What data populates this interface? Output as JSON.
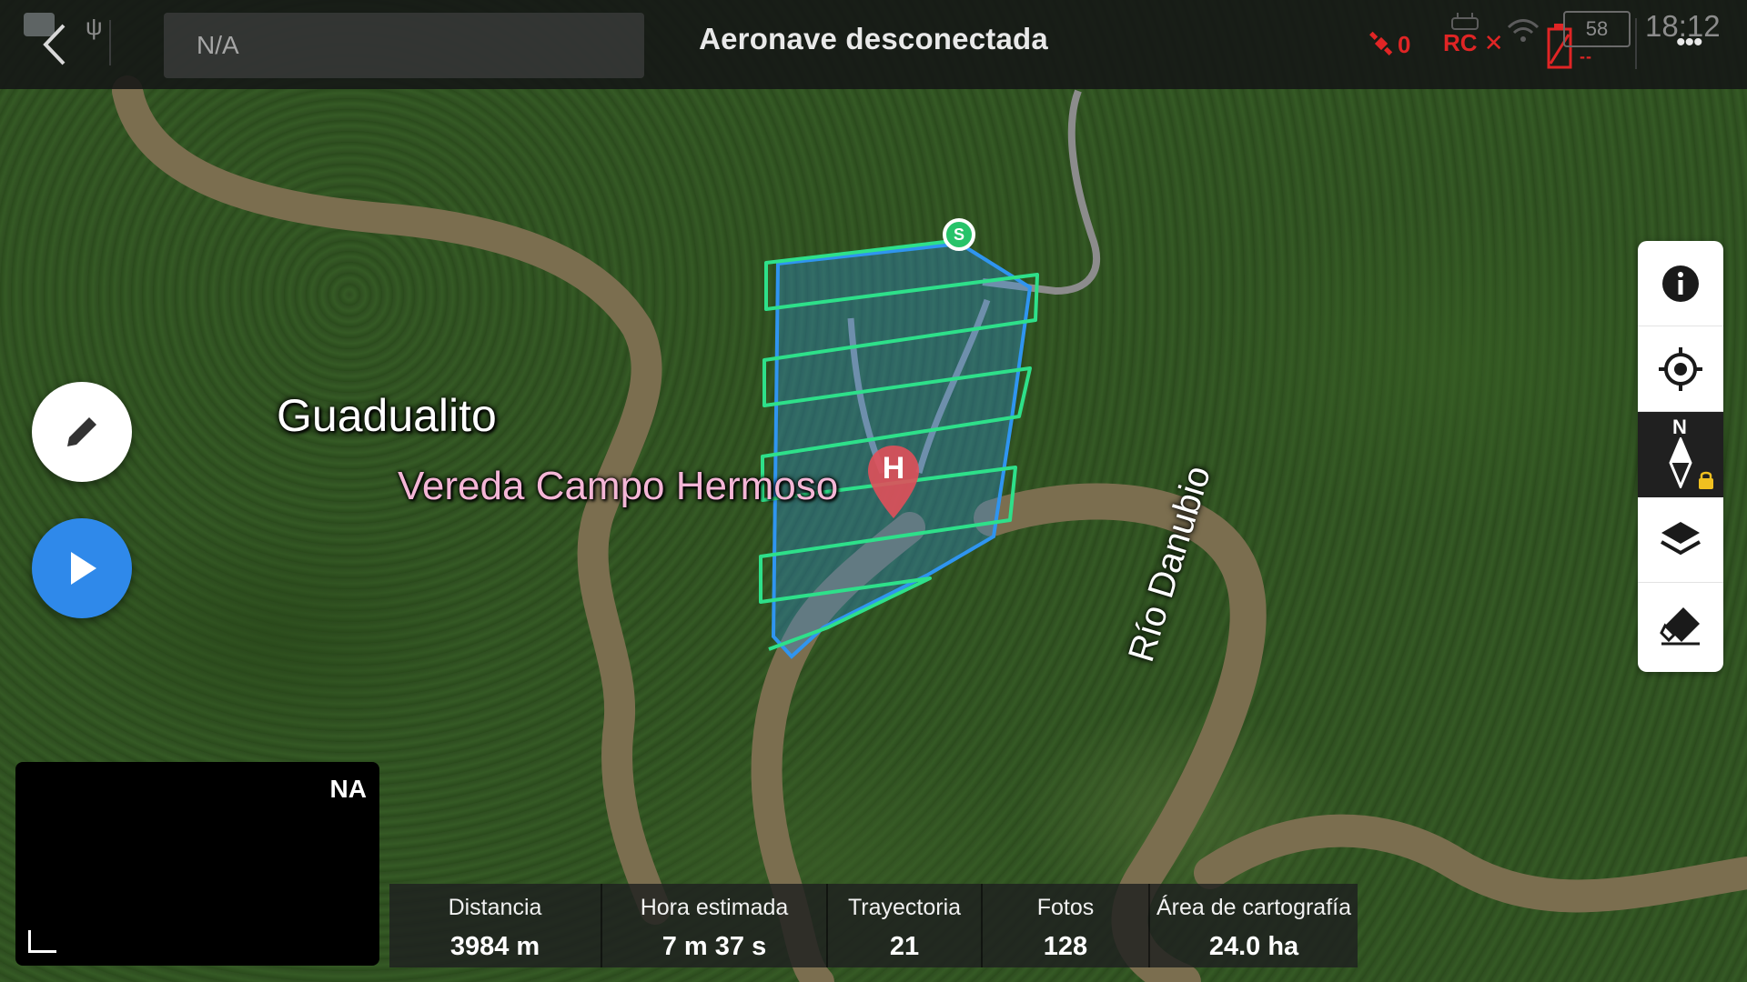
{
  "topbar": {
    "flight_name": "N/A",
    "status": "Aeronave desconectada",
    "satellite_count": "0",
    "rc_label": "RC ✕",
    "battery_level": "58",
    "battery_value": "--",
    "time": "18:12",
    "more": "•••"
  },
  "map": {
    "town_label": "Guadualito",
    "place_label": "Vereda Campo Hermoso",
    "river_label": "Río Danubio",
    "home_marker": "H",
    "start_marker": "S"
  },
  "colors": {
    "area_outline": "#2f95f0",
    "flight_path": "#2ee08a",
    "home_pin": "#e0505a",
    "play_button": "#2f89ea",
    "alert": "#e02525"
  },
  "toolbar": {
    "compass_label": "N"
  },
  "mini_view": {
    "label": "NA"
  },
  "stats": [
    {
      "label": "Distancia",
      "value": "3984 m"
    },
    {
      "label": "Hora estimada",
      "value": "7 m 37 s"
    },
    {
      "label": "Trayectoria",
      "value": "21"
    },
    {
      "label": "Fotos",
      "value": "128"
    },
    {
      "label": "Área de cartografía",
      "value": "24.0 ha"
    }
  ]
}
